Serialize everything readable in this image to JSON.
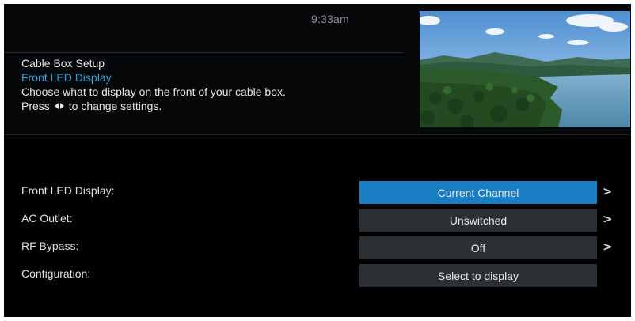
{
  "header": {
    "clock": "9:33am",
    "section_title": "Cable Box Setup",
    "setting_name": "Front LED Display",
    "description": "Choose what to display on the front of your cable box.",
    "hint_prefix": "Press",
    "hint_suffix": "to change settings.",
    "hint_icon": "left-right-arrows-icon"
  },
  "preview": {
    "content": "live-tv-preview"
  },
  "settings": [
    {
      "label": "Front LED Display:",
      "value": "Current Channel",
      "selected": true,
      "has_arrow": true
    },
    {
      "label": "AC Outlet:",
      "value": "Unswitched",
      "selected": false,
      "has_arrow": true
    },
    {
      "label": "RF Bypass:",
      "value": "Off",
      "selected": false,
      "has_arrow": true
    },
    {
      "label": "Configuration:",
      "value": "Select to display",
      "selected": false,
      "has_arrow": false
    }
  ],
  "chevron": ">",
  "colors": {
    "accent": "#1a7ec4",
    "subtitle": "#2aa3e0",
    "value_bg": "#2c2f33",
    "background": "#000000"
  }
}
